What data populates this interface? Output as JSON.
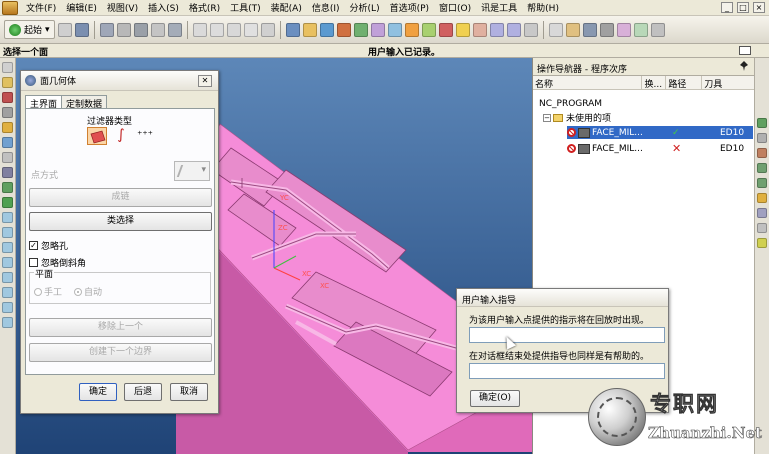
{
  "menu": {
    "items": [
      "文件(F)",
      "编辑(E)",
      "视图(V)",
      "插入(S)",
      "格式(R)",
      "工具(T)",
      "装配(A)",
      "信息(I)",
      "分析(L)",
      "首选项(P)",
      "窗口(O)",
      "讯是工具",
      "帮助(H)"
    ],
    "window_buttons": [
      "_",
      "□",
      "×"
    ]
  },
  "toolbar": {
    "start_label": "起始",
    "start_arrow": "▾"
  },
  "status": {
    "left": "选择一个面",
    "center": "用户输入已记录。"
  },
  "navigator": {
    "title": "操作导航器 - 程序次序",
    "columns": [
      "名称",
      "换...",
      "路径",
      "刀具"
    ],
    "rows": [
      {
        "name": "NC_PROGRAM",
        "path": "",
        "tool": ""
      },
      {
        "name": "未使用的项",
        "path": "",
        "tool": ""
      },
      {
        "name": "FACE_MIL...",
        "path": "✓",
        "tool": "ED10"
      },
      {
        "name": "FACE_MIL...",
        "path": "✕",
        "tool": "ED10"
      }
    ],
    "expander": "−"
  },
  "face_dialog": {
    "title": "面几何体",
    "close": "✕",
    "tabs": [
      "主界面",
      "定制数据"
    ],
    "filter_type_label": "过滤器类型",
    "filter_glyphs": [
      "∫",
      "⁺⁺⁺"
    ],
    "point_method_label": "点方式",
    "point_method_arrow": "▾",
    "btn_sheet": "成链",
    "btn_class_select": "类选择",
    "chk_ignore_holes": "忽略孔",
    "chk_ignore_holes_mark": "✓",
    "chk_ignore_chamfer": "忽略倒斜角",
    "plane_label": "平面",
    "radio_manual": "手工",
    "radio_auto": "自动",
    "btn_remove_last": "移除上一个",
    "btn_create_next": "创建下一个边界",
    "ok": "确定",
    "back": "后退",
    "cancel": "取消"
  },
  "guide_dialog": {
    "title": "用户输入指导",
    "msg1": "为该用户输入点提供的指示将在回放时出现。",
    "msg2": "在对话框结束处提供指导也同样是有帮助的。",
    "ok": "确定(O)"
  },
  "watermark": {
    "cn": "专职网",
    "en": "Zhuanzhi.Net"
  },
  "viewport_labels": {
    "zc": "ZC",
    "yc": "YC",
    "xc": "XC"
  },
  "colors": {
    "part_pink": "#f58cd8",
    "viewport_top": "#5d87b8",
    "selection": "#3169c6"
  }
}
